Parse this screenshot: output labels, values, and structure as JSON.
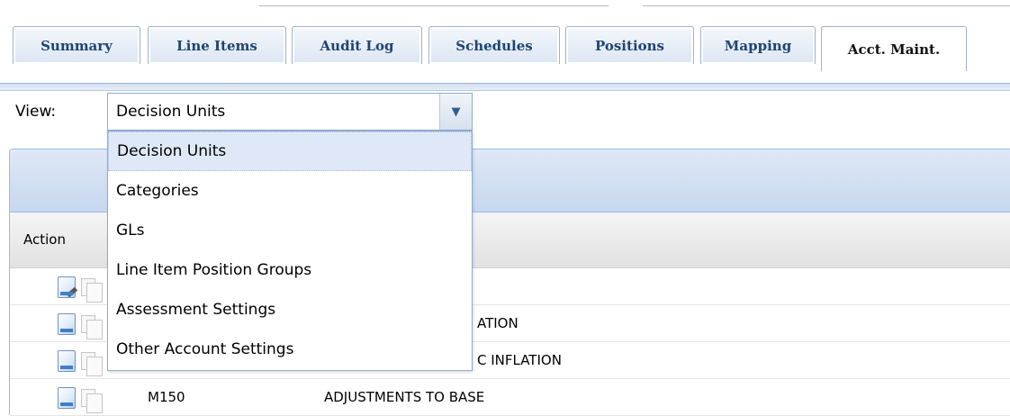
{
  "tabs": [
    {
      "label": "Summary",
      "active": false
    },
    {
      "label": "Line Items",
      "active": false
    },
    {
      "label": "Audit Log",
      "active": false
    },
    {
      "label": "Schedules",
      "active": false
    },
    {
      "label": "Positions",
      "active": false
    },
    {
      "label": "Mapping",
      "active": false
    },
    {
      "label": "Acct. Maint.",
      "active": true
    }
  ],
  "view": {
    "label": "View:",
    "selected": "Decision Units",
    "options": [
      "Decision Units",
      "Categories",
      "GLs",
      "Line Item Position Groups",
      "Assessment Settings",
      "Other Account Settings"
    ]
  },
  "grid": {
    "columns": {
      "action": "Action"
    },
    "rows": [
      {
        "code": "",
        "desc": ""
      },
      {
        "code": "",
        "desc": "ATION"
      },
      {
        "code": "",
        "desc": "C INFLATION"
      },
      {
        "code": "M150",
        "desc": "ADJUSTMENTS TO BASE"
      }
    ]
  },
  "colors": {
    "tab_text": "#1f4473",
    "panel_border": "#99bbe8",
    "selected_option_bg": "#dfe8f6"
  }
}
